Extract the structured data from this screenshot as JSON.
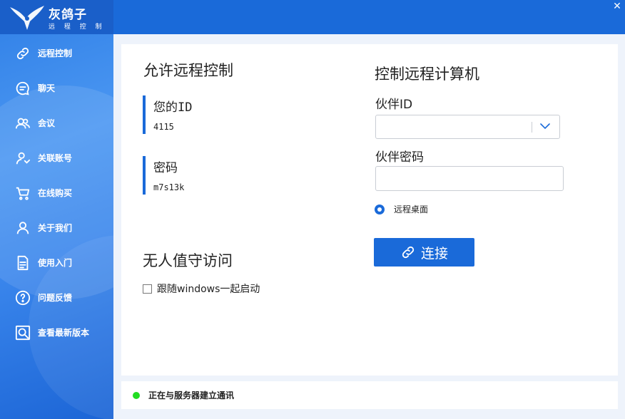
{
  "app": {
    "name": "灰鸽子",
    "subtitle": "远 程 控 制"
  },
  "sidebar": {
    "items": [
      {
        "label": "远程控制",
        "icon": "link-icon"
      },
      {
        "label": "聊天",
        "icon": "chat-icon"
      },
      {
        "label": "会议",
        "icon": "meeting-icon"
      },
      {
        "label": "关联账号",
        "icon": "linked-account-icon"
      },
      {
        "label": "在线购买",
        "icon": "cart-icon"
      },
      {
        "label": "关于我们",
        "icon": "about-us-icon"
      },
      {
        "label": "使用入门",
        "icon": "document-icon"
      },
      {
        "label": "问题反馈",
        "icon": "question-icon"
      },
      {
        "label": "查看最新版本",
        "icon": "search-version-icon"
      }
    ]
  },
  "window": {
    "close_glyph": "✕"
  },
  "allow": {
    "title": "允许远程控制",
    "id_label": "您的ID",
    "id_value": "4115",
    "password_label": "密码",
    "password_value": "m7s13k"
  },
  "unattended": {
    "title": "无人值守访问",
    "checkbox_label": "跟随windows一起启动",
    "checked": false
  },
  "control": {
    "title": "控制远程计算机",
    "partner_id_label": "伙伴ID",
    "partner_id_value": "",
    "partner_password_label": "伙伴密码",
    "partner_password_value": "",
    "mode_label": "远程桌面",
    "connect_label": "连接"
  },
  "status": {
    "text": "正在与服务器建立通讯",
    "color": "#22dd22"
  },
  "colors": {
    "accent": "#1a6ad9",
    "sidebar": "#3a86ec"
  }
}
